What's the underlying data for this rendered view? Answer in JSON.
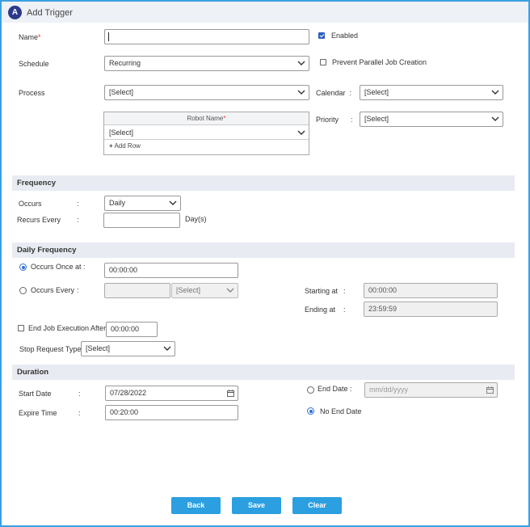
{
  "title_bar": {
    "logo_letter": "A",
    "title": "Add Trigger"
  },
  "form": {
    "name_label": "Name",
    "required_mark": "*",
    "name_value": "",
    "enabled_label": "Enabled",
    "enabled_checked": true,
    "schedule_label": "Schedule",
    "schedule_value": "Recurring",
    "prevent_parallel_label": "Prevent Parallel Job Creation",
    "process_label": "Process",
    "process_value": "[Select]",
    "calendar_label": "Calendar",
    "calendar_colon": ":",
    "calendar_value": "[Select]",
    "robot_table": {
      "header": "Robot Name",
      "required_mark": "*",
      "row_value": "[Select]",
      "add_row": "Add Row",
      "add_icon": "plus-icon"
    },
    "priority_label": "Priority",
    "priority_colon": ":",
    "priority_value": "[Select]"
  },
  "frequency": {
    "heading": "Frequency",
    "occurs_label": "Occurs",
    "colon": ":",
    "occurs_value": "Daily",
    "recurs_label": "Recurs Every",
    "recurs_value": "",
    "recurs_unit": "Day(s)"
  },
  "daily_frequency": {
    "heading": "Daily Frequency",
    "once_label": "Occurs Once at :",
    "once_value": "00:00:00",
    "every_label": "Occurs Every",
    "colon": ":",
    "every_value": "",
    "every_unit": "[Select]",
    "starting_label": "Starting at",
    "starting_value": "00:00:00",
    "ending_label": "Ending at",
    "ending_value": "23:59:59",
    "end_exec_label": "End Job Execution After",
    "end_exec_value": "00:00:00",
    "stop_request_label": "Stop Request Type",
    "stop_request_value": "[Select]"
  },
  "duration": {
    "heading": "Duration",
    "start_date_label": "Start Date",
    "colon": ":",
    "start_date_value": "07/28/2022",
    "expire_label": "Expire Time",
    "expire_value": "00:20:00",
    "end_date_label": "End Date :",
    "end_date_placeholder": "mm/dd/yyyy",
    "no_end_date_label": "No End Date"
  },
  "buttons": {
    "back": "Back",
    "save": "Save",
    "clear": "Clear"
  },
  "colors": {
    "accent": "#2b9fe0",
    "frame": "#3aa0e0",
    "section_bg": "#e8ebf2",
    "logo": "#2c3a8c"
  }
}
